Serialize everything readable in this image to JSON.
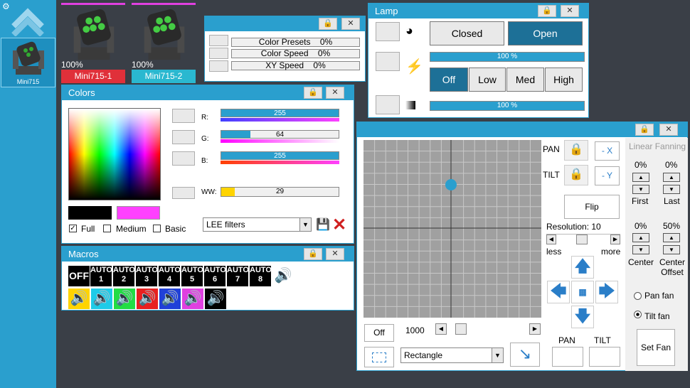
{
  "fixture_group": {
    "label": "Mini715"
  },
  "fixtures": [
    {
      "name": "Mini715-1",
      "pct": "100%",
      "color": "#e0303a"
    },
    {
      "name": "Mini715-2",
      "pct": "100%",
      "color": "#2ab8d0"
    }
  ],
  "speeds": {
    "rows": [
      {
        "label": "Color Presets",
        "value": "0%"
      },
      {
        "label": "Color Speed",
        "value": "0%"
      },
      {
        "label": "XY Speed",
        "value": "0%"
      }
    ]
  },
  "lamp": {
    "title": "Lamp",
    "closed": "Closed",
    "open": "Open",
    "dimmer_pct": "100 %",
    "off": "Off",
    "low": "Low",
    "med": "Med",
    "high": "High",
    "intensity_pct": "100 %"
  },
  "colors": {
    "title": "Colors",
    "r_label": "R:",
    "r_value": "255",
    "g_label": "G:",
    "g_value": "64",
    "b_label": "B:",
    "b_value": "255",
    "ww_label": "WW:",
    "ww_value": "29",
    "full": "Full",
    "medium": "Medium",
    "basic": "Basic",
    "filter": "LEE filters",
    "r": 255,
    "g": 64,
    "b": 255,
    "ww": 29
  },
  "macros": {
    "title": "Macros",
    "off": "OFF",
    "auto": [
      {
        "top": "AUTO",
        "num": "1"
      },
      {
        "top": "AUTO",
        "num": "2"
      },
      {
        "top": "AUTO",
        "num": "3"
      },
      {
        "top": "AUTO",
        "num": "4"
      },
      {
        "top": "AUTO",
        "num": "5"
      },
      {
        "top": "AUTO",
        "num": "6"
      },
      {
        "top": "AUTO",
        "num": "7"
      },
      {
        "top": "AUTO",
        "num": "8"
      }
    ],
    "sound_colors": [
      "#ffd400",
      "#1ecbe8",
      "#22dd44",
      "#e82020",
      "#2040d8",
      "#e040e0",
      "#000000"
    ]
  },
  "xy": {
    "pan": "PAN",
    "tilt": "TILT",
    "neg_x": "- X",
    "neg_y": "- Y",
    "flip": "Flip",
    "resolution": "Resolution: 10",
    "less": "less",
    "more": "more",
    "off": "Off",
    "value": "1000",
    "shape": "Rectangle",
    "pan_label": "PAN",
    "tilt_label": "TILT"
  },
  "fanning": {
    "title": "Linear Fanning",
    "first_pct": "0%",
    "last_pct": "0%",
    "first": "First",
    "last": "Last",
    "center_pct": "0%",
    "offset_pct": "50%",
    "center": "Center",
    "center_offset": "Center Offset",
    "pan_fan": "Pan fan",
    "tilt_fan": "Tilt fan",
    "set_fan": "Set Fan"
  }
}
